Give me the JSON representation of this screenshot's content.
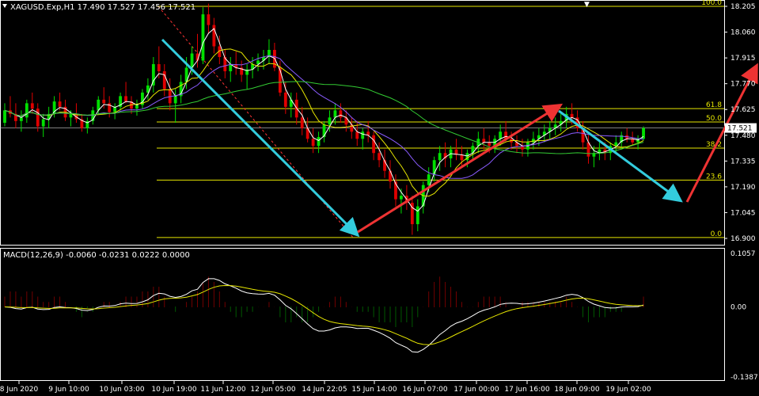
{
  "window": {
    "symbol_header": "XAGUSD.Exp,H1  17.490 17.527 17.456 17.521",
    "macd_header": "MACD(12,26,9) -0.0060 -0.0231 0.0222 0.0000"
  },
  "chart_data": {
    "type": "candlestick",
    "timeframe": "H1",
    "price_axis": {
      "ylim": [
        16.9,
        18.23
      ],
      "ticks": [
        "18.205",
        "18.060",
        "17.915",
        "17.770",
        "17.625",
        "17.480",
        "17.335",
        "17.190",
        "17.045",
        "16.900"
      ],
      "current_price": "17.521"
    },
    "time_axis": {
      "ticks": [
        "8 Jun 2020",
        "9 Jun 10:00",
        "10 Jun 03:00",
        "10 Jun 19:00",
        "11 Jun 12:00",
        "12 Jun 05:00",
        "14 Jun 22:05",
        "15 Jun 14:00",
        "16 Jun 07:00",
        "17 Jun 00:00",
        "17 Jun 16:00",
        "18 Jun 09:00",
        "19 Jun 02:00"
      ]
    },
    "fibonacci": {
      "high": 18.205,
      "low": 16.905,
      "levels": [
        {
          "label": "100.0",
          "price": 18.205
        },
        {
          "label": "61.8",
          "price": 17.63
        },
        {
          "label": "50.0",
          "price": 17.555
        },
        {
          "label": "38.2",
          "price": 17.408
        },
        {
          "label": "23.6",
          "price": 17.228
        },
        {
          "label": "0.0",
          "price": 16.905
        }
      ]
    },
    "candles": [
      [
        17.55,
        17.66,
        17.53,
        17.62
      ],
      [
        17.62,
        17.7,
        17.58,
        17.6
      ],
      [
        17.6,
        17.66,
        17.52,
        17.56
      ],
      [
        17.56,
        17.62,
        17.5,
        17.58
      ],
      [
        17.58,
        17.68,
        17.55,
        17.66
      ],
      [
        17.66,
        17.72,
        17.6,
        17.63
      ],
      [
        17.63,
        17.66,
        17.5,
        17.53
      ],
      [
        17.53,
        17.6,
        17.47,
        17.57
      ],
      [
        17.57,
        17.64,
        17.52,
        17.6
      ],
      [
        17.6,
        17.7,
        17.58,
        17.67
      ],
      [
        17.67,
        17.72,
        17.62,
        17.64
      ],
      [
        17.64,
        17.68,
        17.56,
        17.58
      ],
      [
        17.58,
        17.62,
        17.53,
        17.6
      ],
      [
        17.6,
        17.66,
        17.55,
        17.57
      ],
      [
        17.57,
        17.6,
        17.5,
        17.52
      ],
      [
        17.52,
        17.58,
        17.49,
        17.56
      ],
      [
        17.56,
        17.64,
        17.54,
        17.62
      ],
      [
        17.62,
        17.7,
        17.6,
        17.68
      ],
      [
        17.68,
        17.75,
        17.63,
        17.66
      ],
      [
        17.66,
        17.7,
        17.58,
        17.61
      ],
      [
        17.61,
        17.66,
        17.57,
        17.64
      ],
      [
        17.64,
        17.72,
        17.62,
        17.7
      ],
      [
        17.7,
        17.78,
        17.66,
        17.67
      ],
      [
        17.67,
        17.7,
        17.6,
        17.63
      ],
      [
        17.63,
        17.68,
        17.59,
        17.65
      ],
      [
        17.65,
        17.74,
        17.63,
        17.72
      ],
      [
        17.72,
        17.8,
        17.68,
        17.76
      ],
      [
        17.76,
        17.92,
        17.72,
        17.88
      ],
      [
        17.88,
        17.98,
        17.8,
        17.84
      ],
      [
        17.84,
        17.88,
        17.7,
        17.74
      ],
      [
        17.74,
        17.8,
        17.62,
        17.66
      ],
      [
        17.66,
        17.74,
        17.55,
        17.7
      ],
      [
        17.7,
        17.82,
        17.66,
        17.78
      ],
      [
        17.78,
        17.92,
        17.74,
        17.86
      ],
      [
        17.86,
        17.98,
        17.82,
        17.94
      ],
      [
        17.94,
        18.05,
        17.86,
        17.9
      ],
      [
        17.9,
        18.2,
        17.88,
        18.16
      ],
      [
        18.16,
        18.22,
        18.05,
        18.1
      ],
      [
        18.1,
        18.14,
        17.94,
        17.98
      ],
      [
        17.98,
        18.04,
        17.88,
        17.92
      ],
      [
        17.92,
        17.96,
        17.8,
        17.84
      ],
      [
        17.84,
        17.92,
        17.78,
        17.88
      ],
      [
        17.88,
        17.95,
        17.82,
        17.86
      ],
      [
        17.86,
        17.9,
        17.78,
        17.82
      ],
      [
        17.82,
        17.88,
        17.74,
        17.85
      ],
      [
        17.85,
        17.92,
        17.8,
        17.88
      ],
      [
        17.88,
        17.94,
        17.84,
        17.9
      ],
      [
        17.9,
        17.96,
        17.85,
        17.92
      ],
      [
        17.92,
        18.02,
        17.88,
        17.96
      ],
      [
        17.96,
        18.0,
        17.84,
        17.86
      ],
      [
        17.86,
        17.9,
        17.7,
        17.72
      ],
      [
        17.72,
        17.78,
        17.6,
        17.64
      ],
      [
        17.64,
        17.72,
        17.58,
        17.68
      ],
      [
        17.68,
        17.72,
        17.54,
        17.58
      ],
      [
        17.58,
        17.64,
        17.48,
        17.52
      ],
      [
        17.52,
        17.58,
        17.44,
        17.46
      ],
      [
        17.46,
        17.52,
        17.38,
        17.42
      ],
      [
        17.42,
        17.5,
        17.38,
        17.47
      ],
      [
        17.47,
        17.56,
        17.44,
        17.54
      ],
      [
        17.54,
        17.62,
        17.5,
        17.58
      ],
      [
        17.58,
        17.66,
        17.54,
        17.62
      ],
      [
        17.62,
        17.66,
        17.55,
        17.58
      ],
      [
        17.58,
        17.62,
        17.5,
        17.54
      ],
      [
        17.54,
        17.58,
        17.46,
        17.5
      ],
      [
        17.5,
        17.56,
        17.42,
        17.46
      ],
      [
        17.46,
        17.52,
        17.4,
        17.5
      ],
      [
        17.5,
        17.56,
        17.44,
        17.48
      ],
      [
        17.48,
        17.5,
        17.34,
        17.38
      ],
      [
        17.38,
        17.44,
        17.3,
        17.34
      ],
      [
        17.34,
        17.4,
        17.24,
        17.28
      ],
      [
        17.28,
        17.34,
        17.18,
        17.22
      ],
      [
        17.22,
        17.26,
        17.08,
        17.12
      ],
      [
        17.12,
        17.18,
        17.04,
        17.14
      ],
      [
        17.14,
        17.2,
        17.06,
        17.1
      ],
      [
        17.1,
        17.14,
        16.92,
        16.98
      ],
      [
        16.98,
        17.12,
        16.94,
        17.08
      ],
      [
        17.08,
        17.22,
        17.04,
        17.2
      ],
      [
        17.2,
        17.3,
        17.16,
        17.26
      ],
      [
        17.26,
        17.36,
        17.22,
        17.34
      ],
      [
        17.34,
        17.42,
        17.28,
        17.38
      ],
      [
        17.38,
        17.44,
        17.3,
        17.35
      ],
      [
        17.35,
        17.42,
        17.3,
        17.4
      ],
      [
        17.4,
        17.46,
        17.34,
        17.37
      ],
      [
        17.37,
        17.42,
        17.3,
        17.34
      ],
      [
        17.34,
        17.4,
        17.3,
        17.38
      ],
      [
        17.38,
        17.44,
        17.34,
        17.42
      ],
      [
        17.42,
        17.5,
        17.38,
        17.46
      ],
      [
        17.46,
        17.52,
        17.4,
        17.44
      ],
      [
        17.44,
        17.48,
        17.38,
        17.42
      ],
      [
        17.42,
        17.48,
        17.38,
        17.46
      ],
      [
        17.46,
        17.54,
        17.42,
        17.5
      ],
      [
        17.5,
        17.56,
        17.44,
        17.46
      ],
      [
        17.46,
        17.5,
        17.4,
        17.44
      ],
      [
        17.44,
        17.48,
        17.38,
        17.42
      ],
      [
        17.42,
        17.46,
        17.36,
        17.4
      ],
      [
        17.4,
        17.46,
        17.36,
        17.44
      ],
      [
        17.44,
        17.5,
        17.4,
        17.46
      ],
      [
        17.46,
        17.52,
        17.42,
        17.48
      ],
      [
        17.48,
        17.54,
        17.44,
        17.5
      ],
      [
        17.5,
        17.56,
        17.46,
        17.52
      ],
      [
        17.52,
        17.58,
        17.48,
        17.54
      ],
      [
        17.54,
        17.6,
        17.5,
        17.56
      ],
      [
        17.56,
        17.64,
        17.52,
        17.6
      ],
      [
        17.6,
        17.66,
        17.54,
        17.58
      ],
      [
        17.58,
        17.62,
        17.5,
        17.52
      ],
      [
        17.52,
        17.56,
        17.4,
        17.44
      ],
      [
        17.44,
        17.48,
        17.32,
        17.36
      ],
      [
        17.36,
        17.42,
        17.3,
        17.38
      ],
      [
        17.38,
        17.44,
        17.34,
        17.4
      ],
      [
        17.4,
        17.44,
        17.34,
        17.38
      ],
      [
        17.38,
        17.44,
        17.34,
        17.42
      ],
      [
        17.42,
        17.48,
        17.38,
        17.44
      ],
      [
        17.44,
        17.5,
        17.4,
        17.48
      ],
      [
        17.48,
        17.52,
        17.44,
        17.46
      ],
      [
        17.46,
        17.5,
        17.42,
        17.44
      ],
      [
        17.44,
        17.48,
        17.4,
        17.46
      ],
      [
        17.46,
        17.53,
        17.45,
        17.52
      ]
    ],
    "macd": {
      "ylim": [
        -0.1387,
        0.1057
      ],
      "ticks": [
        "0.1057",
        "0.00",
        "-0.1387"
      ],
      "histogram": [
        0.02,
        0.03,
        0.03,
        0.02,
        0.03,
        0.03,
        0.02,
        0.01,
        0.01,
        0.02,
        0.02,
        0.01,
        0.0,
        -0.01,
        -0.02,
        -0.01,
        -0.01,
        0.0,
        0.01,
        0.01,
        0.0,
        0.01,
        0.02,
        0.02,
        0.02,
        0.03,
        0.03,
        0.04,
        0.04,
        0.02,
        0.0,
        -0.01,
        0.0,
        0.01,
        0.02,
        0.03,
        0.05,
        0.06,
        0.05,
        0.03,
        0.01,
        -0.01,
        -0.02,
        -0.02,
        -0.01,
        -0.01,
        0.0,
        0.0,
        0.01,
        0.0,
        -0.02,
        -0.03,
        -0.03,
        -0.02,
        -0.03,
        -0.03,
        -0.02,
        -0.01,
        0.0,
        0.01,
        0.02,
        0.02,
        0.01,
        0.0,
        -0.01,
        -0.01,
        -0.01,
        -0.02,
        -0.03,
        -0.03,
        -0.03,
        -0.04,
        -0.03,
        -0.03,
        -0.04,
        -0.02,
        0.0,
        0.03,
        0.05,
        0.06,
        0.05,
        0.04,
        0.03,
        0.01,
        0.0,
        0.0,
        0.01,
        0.02,
        0.02,
        0.02,
        0.02,
        0.01,
        0.0,
        0.0,
        0.01,
        0.01,
        0.01,
        0.01,
        0.01,
        0.01,
        0.01,
        0.01,
        0.02,
        0.01,
        0.0,
        -0.02,
        -0.03,
        -0.02,
        -0.02,
        -0.02,
        -0.01,
        -0.01,
        -0.01,
        0.0,
        0.0,
        0.0,
        0.02
      ]
    }
  }
}
